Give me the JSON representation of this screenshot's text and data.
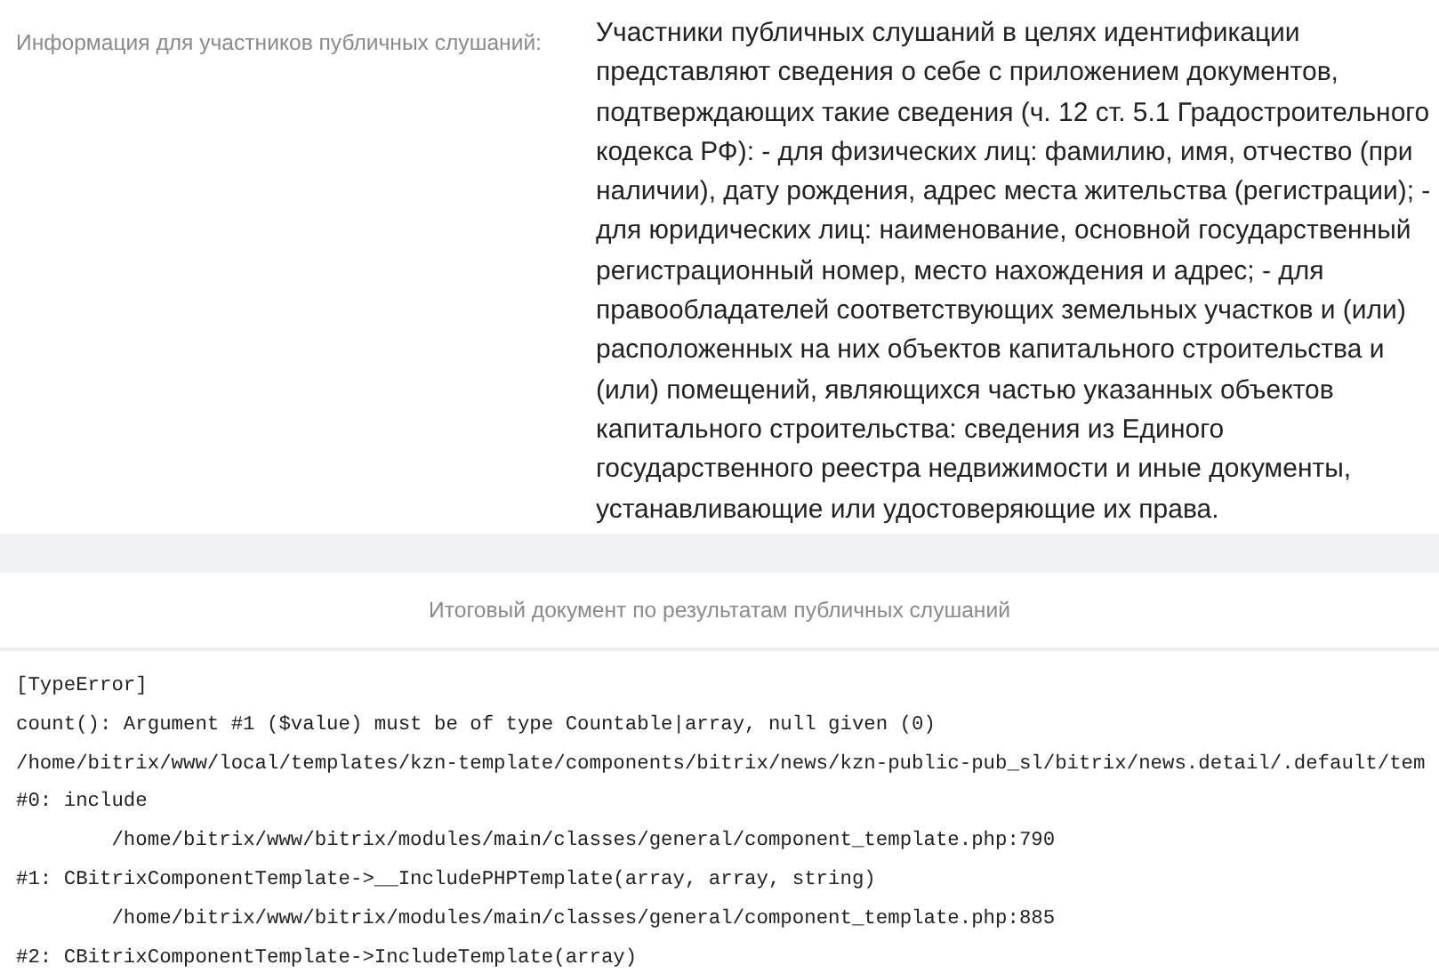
{
  "info": {
    "label": "Информация для участников публичных слушаний:",
    "text": "Участники публичных слушаний в целях идентификации представляют сведения о себе с приложением документов, подтверждающих такие сведения (ч. 12 ст. 5.1 Градостроительного кодекса РФ): - для физических лиц: фамилию, имя, отчество (при наличии), дату рождения, адрес места жительства (регистрации); - для юридических лиц: наименование, основной государственный регистрационный номер, место нахождения и адрес; - для правообладателей соответствующих земельных участков и (или) расположенных на них объектов капитального строительства и (или) помещений, являющихся частью указанных объектов капитального строительства: сведения из Единого государственного реестра недвижимости и иные документы, устанавливающие или удостоверяющие их права."
  },
  "document_section": {
    "title": "Итоговый документ по результатам публичных слушаний"
  },
  "error_output": {
    "lines": [
      "[TypeError]",
      "count(): Argument #1 ($value) must be of type Countable|array, null given (0)",
      "/home/bitrix/www/local/templates/kzn-template/components/bitrix/news/kzn-public-pub_sl/bitrix/news.detail/.default/tem",
      "#0: include",
      "\t/home/bitrix/www/bitrix/modules/main/classes/general/component_template.php:790",
      "#1: CBitrixComponentTemplate->__IncludePHPTemplate(array, array, string)",
      "\t/home/bitrix/www/bitrix/modules/main/classes/general/component_template.php:885",
      "#2: CBitrixComponentTemplate->IncludeTemplate(array)"
    ]
  }
}
